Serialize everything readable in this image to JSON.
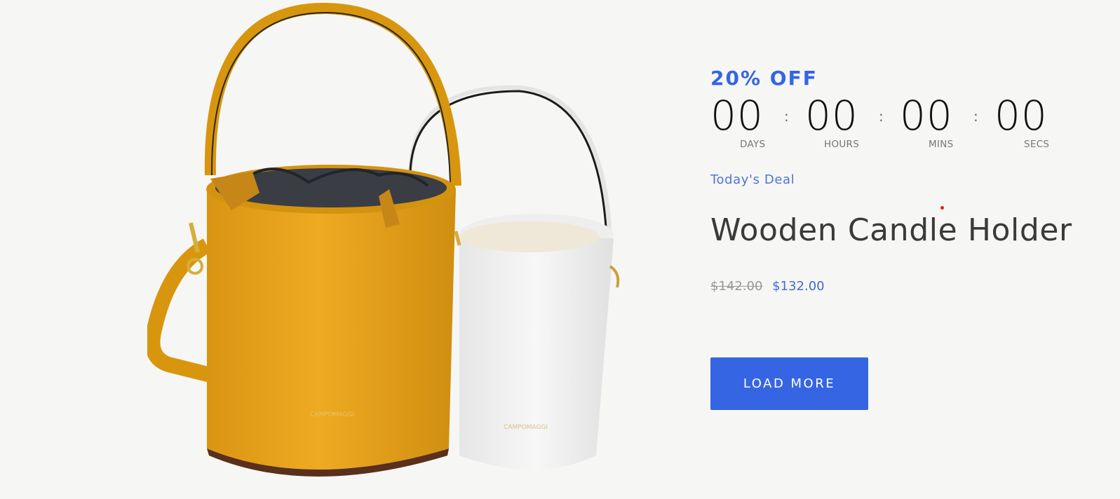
{
  "deal": {
    "discount_label": "20% OFF",
    "countdown": [
      {
        "value": "00",
        "label": "DAYS"
      },
      {
        "value": "00",
        "label": "HOURS"
      },
      {
        "value": "00",
        "label": "MINS"
      },
      {
        "value": "00",
        "label": "SECS"
      }
    ],
    "separator": ":",
    "tag": "Today's Deal",
    "product_title": "Wooden Candle Holder",
    "old_price": "$142.00",
    "new_price": "$132.00",
    "cta_label": "LOAD MORE"
  },
  "colors": {
    "accent": "#3565e3",
    "background": "#f6f6f4",
    "bag_front": "#e6a520",
    "bag_back": "#ececec"
  },
  "image": {
    "subject": "yellow and white leather bucket bags"
  }
}
